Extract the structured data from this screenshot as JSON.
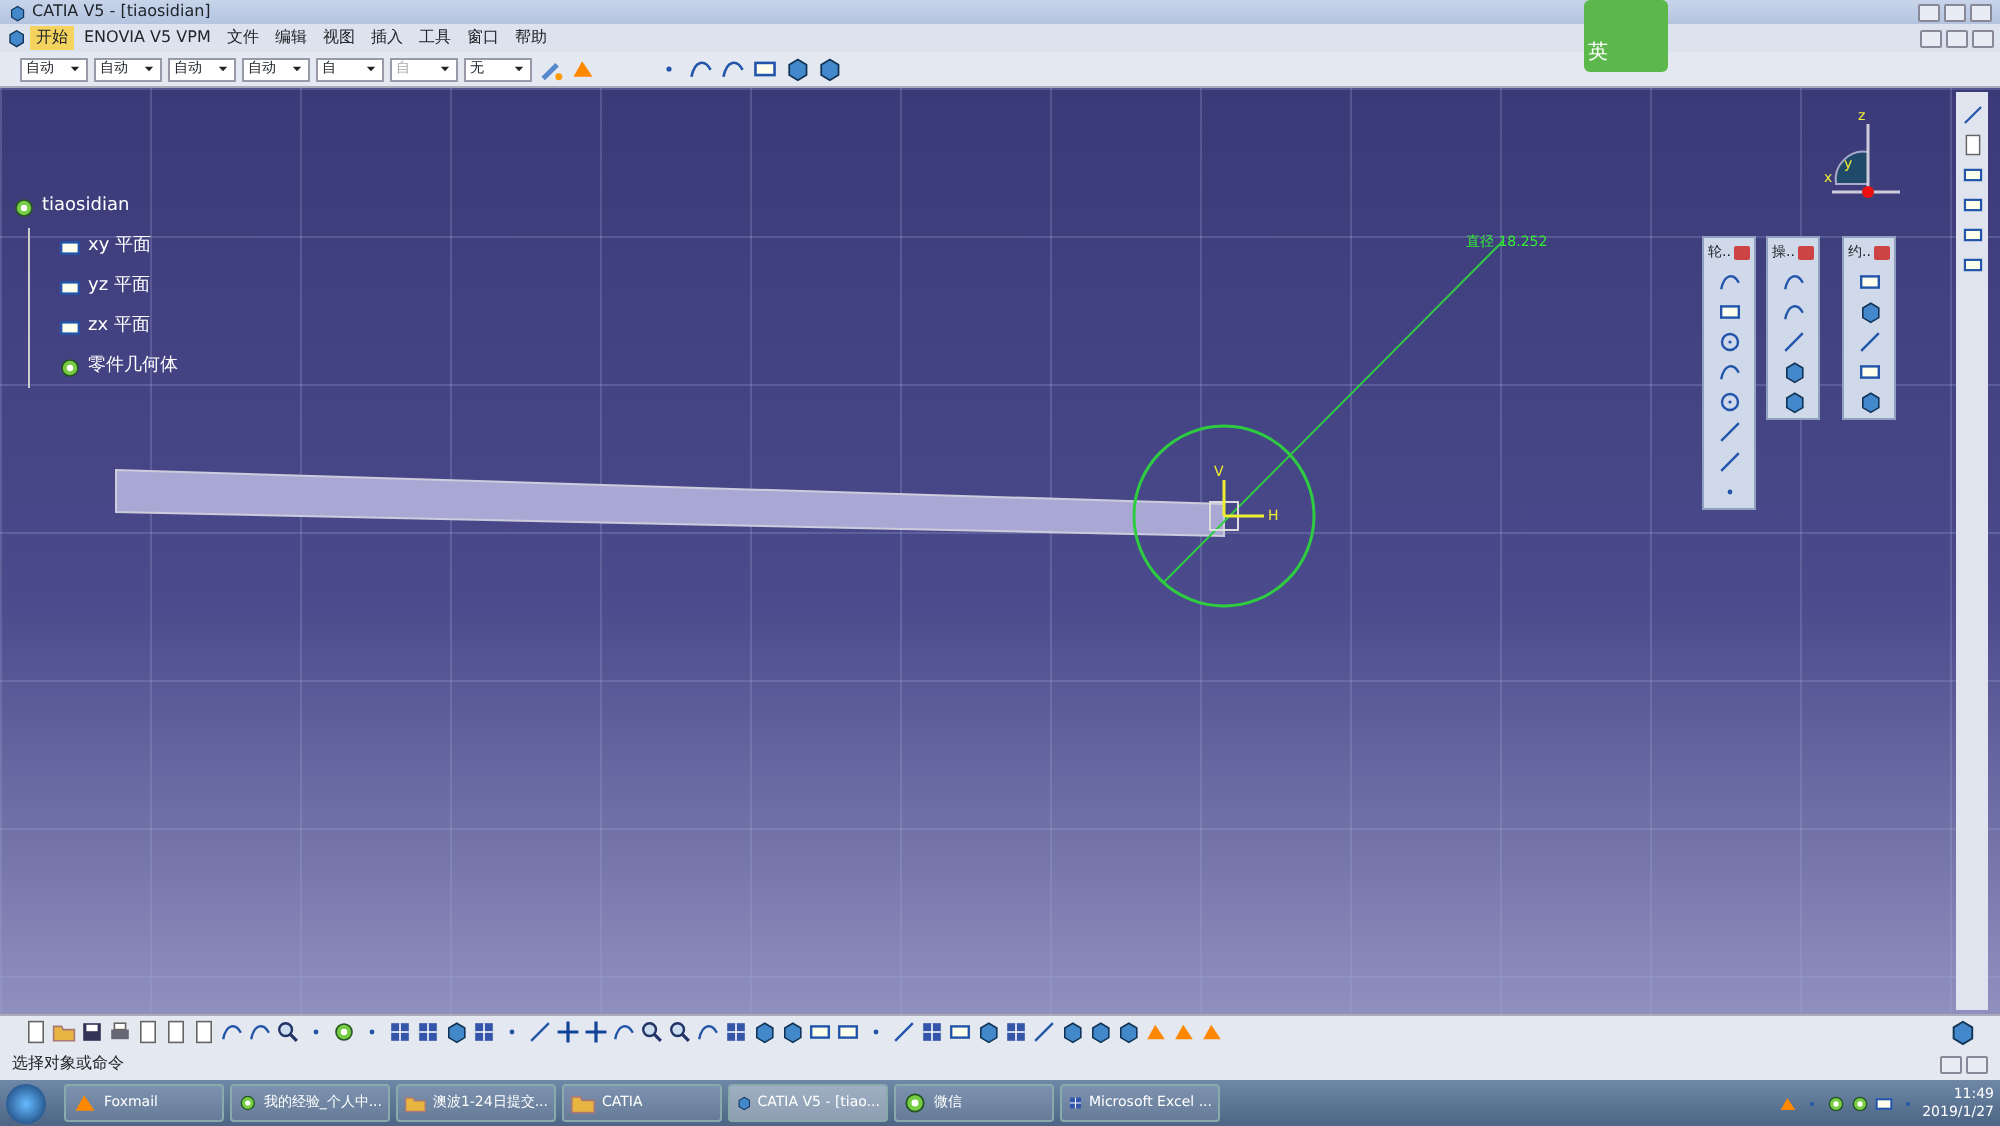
{
  "window": {
    "title": "CATIA V5 - [tiaosidian]"
  },
  "menu": [
    {
      "label": "开始",
      "selected": true
    },
    {
      "label": "ENOVIA V5 VPM",
      "selected": false
    },
    {
      "label": "文件",
      "selected": false
    },
    {
      "label": "编辑",
      "selected": false
    },
    {
      "label": "视图",
      "selected": false
    },
    {
      "label": "插入",
      "selected": false
    },
    {
      "label": "工具",
      "selected": false
    },
    {
      "label": "窗口",
      "selected": false
    },
    {
      "label": "帮助",
      "selected": false
    }
  ],
  "ime": {
    "label": "英"
  },
  "dropdowns": [
    {
      "value": "自动",
      "disabled": false
    },
    {
      "value": "自动",
      "disabled": false
    },
    {
      "value": "自动",
      "disabled": false
    },
    {
      "value": "自动",
      "disabled": false
    },
    {
      "value": "自",
      "disabled": false
    },
    {
      "value": "自",
      "disabled": true
    },
    {
      "value": "无",
      "disabled": false
    }
  ],
  "tree": {
    "label": "tiaosidian",
    "children": [
      {
        "label": "xy 平面",
        "kind": "plane"
      },
      {
        "label": "yz 平面",
        "kind": "plane"
      },
      {
        "label": "zx 平面",
        "kind": "plane"
      },
      {
        "label": "零件几何体",
        "kind": "body"
      }
    ]
  },
  "dimension": {
    "label": "直径 18.252"
  },
  "axis_labels": {
    "h": "H",
    "v": "V"
  },
  "compass": {
    "x": "x",
    "y": "y",
    "z": "z"
  },
  "floating_toolbars": [
    {
      "title": "轮.."
    },
    {
      "title": "操.."
    },
    {
      "title": "约.."
    }
  ],
  "status_bar": "选择对象或命令",
  "taskbar": {
    "items": [
      {
        "label": "Foxmail",
        "selected": false
      },
      {
        "label": "我的经验_个人中...",
        "selected": false
      },
      {
        "label": "澳波1-24日提交...",
        "selected": false
      },
      {
        "label": "CATIA",
        "selected": false
      },
      {
        "label": "CATIA V5 - [tiao...",
        "selected": true
      },
      {
        "label": "微信",
        "selected": false
      },
      {
        "label": "Microsoft Excel ...",
        "selected": false
      }
    ],
    "time": "11:49",
    "date": "2019/1/27"
  }
}
